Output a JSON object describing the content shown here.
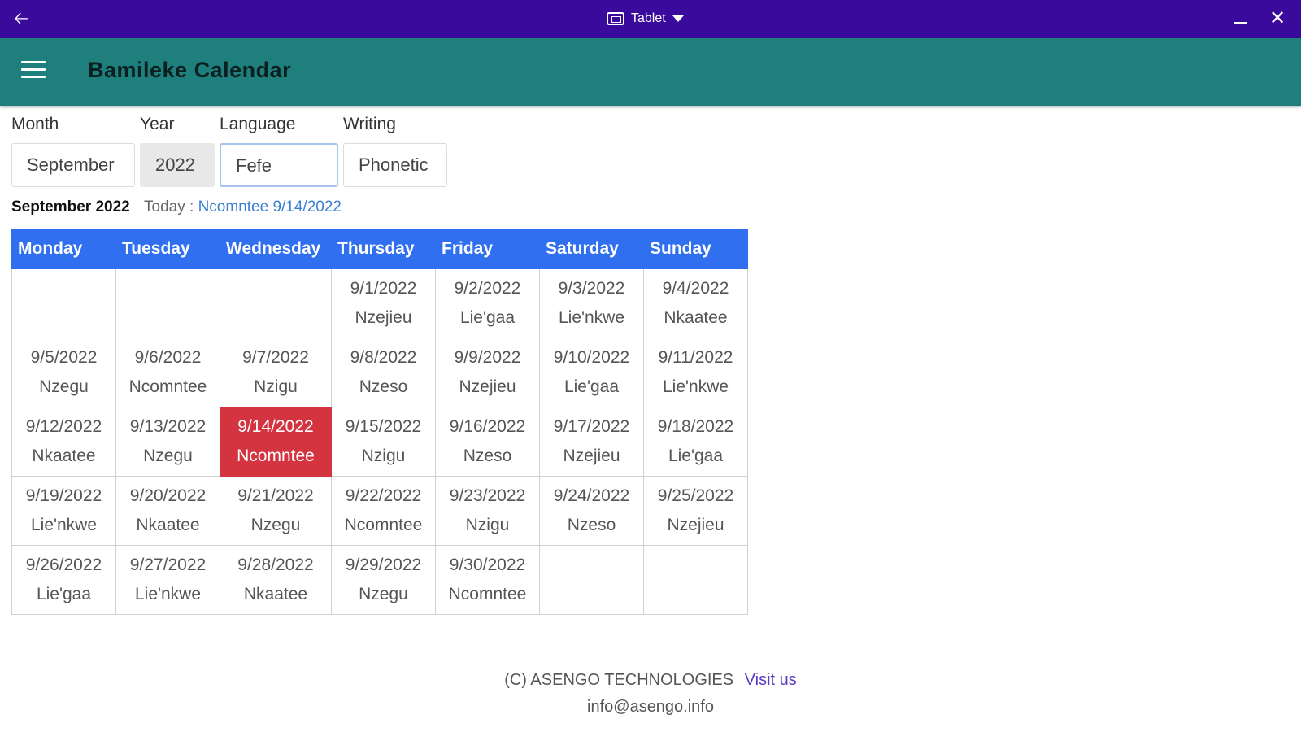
{
  "titlebar": {
    "mode_label": "Tablet"
  },
  "appbar": {
    "title": "Bamileke Calendar"
  },
  "form": {
    "month_label": "Month",
    "month_value": "September",
    "year_label": "Year",
    "year_value": "2022",
    "language_label": "Language",
    "language_value": "Fefe",
    "writing_label": "Writing",
    "writing_value": "Phonetic"
  },
  "info": {
    "month_year": "September 2022",
    "today_label": "Today :",
    "today_value": "Ncomntee 9/14/2022"
  },
  "calendar": {
    "headers": [
      "Monday",
      "Tuesday",
      "Wednesday",
      "Thursday",
      "Friday",
      "Saturday",
      "Sunday"
    ],
    "today": "9/14/2022",
    "weeks": [
      [
        {
          "date": "",
          "name": ""
        },
        {
          "date": "",
          "name": ""
        },
        {
          "date": "",
          "name": ""
        },
        {
          "date": "9/1/2022",
          "name": "Nzejieu"
        },
        {
          "date": "9/2/2022",
          "name": "Lie'gaa"
        },
        {
          "date": "9/3/2022",
          "name": "Lie'nkwe"
        },
        {
          "date": "9/4/2022",
          "name": "Nkaatee"
        }
      ],
      [
        {
          "date": "9/5/2022",
          "name": "Nzegu"
        },
        {
          "date": "9/6/2022",
          "name": "Ncomntee"
        },
        {
          "date": "9/7/2022",
          "name": "Nzigu"
        },
        {
          "date": "9/8/2022",
          "name": "Nzeso"
        },
        {
          "date": "9/9/2022",
          "name": "Nzejieu"
        },
        {
          "date": "9/10/2022",
          "name": "Lie'gaa"
        },
        {
          "date": "9/11/2022",
          "name": "Lie'nkwe"
        }
      ],
      [
        {
          "date": "9/12/2022",
          "name": "Nkaatee"
        },
        {
          "date": "9/13/2022",
          "name": "Nzegu"
        },
        {
          "date": "9/14/2022",
          "name": "Ncomntee"
        },
        {
          "date": "9/15/2022",
          "name": "Nzigu"
        },
        {
          "date": "9/16/2022",
          "name": "Nzeso"
        },
        {
          "date": "9/17/2022",
          "name": "Nzejieu"
        },
        {
          "date": "9/18/2022",
          "name": "Lie'gaa"
        }
      ],
      [
        {
          "date": "9/19/2022",
          "name": "Lie'nkwe"
        },
        {
          "date": "9/20/2022",
          "name": "Nkaatee"
        },
        {
          "date": "9/21/2022",
          "name": "Nzegu"
        },
        {
          "date": "9/22/2022",
          "name": "Ncomntee"
        },
        {
          "date": "9/23/2022",
          "name": "Nzigu"
        },
        {
          "date": "9/24/2022",
          "name": "Nzeso"
        },
        {
          "date": "9/25/2022",
          "name": "Nzejieu"
        }
      ],
      [
        {
          "date": "9/26/2022",
          "name": "Lie'gaa"
        },
        {
          "date": "9/27/2022",
          "name": "Lie'nkwe"
        },
        {
          "date": "9/28/2022",
          "name": "Nkaatee"
        },
        {
          "date": "9/29/2022",
          "name": "Nzegu"
        },
        {
          "date": "9/30/2022",
          "name": "Ncomntee"
        },
        {
          "date": "",
          "name": ""
        },
        {
          "date": "",
          "name": ""
        }
      ]
    ]
  },
  "footer": {
    "copyright": "(C) ASENGO TECHNOLOGIES",
    "link": "Visit us",
    "email": "info@asengo.info"
  },
  "colors": {
    "titlebar": "#3a0a9c",
    "appbar": "#1f7f7c",
    "table_header": "#2f6ff0",
    "today_highlight": "#d4343f",
    "link": "#3b7fd1"
  },
  "icons": {
    "back": "back-arrow-icon",
    "mode": "tablet-icon",
    "dropdown": "caret-down-icon",
    "minimize": "minimize-icon",
    "close": "close-icon",
    "menu": "hamburger-menu-icon"
  }
}
